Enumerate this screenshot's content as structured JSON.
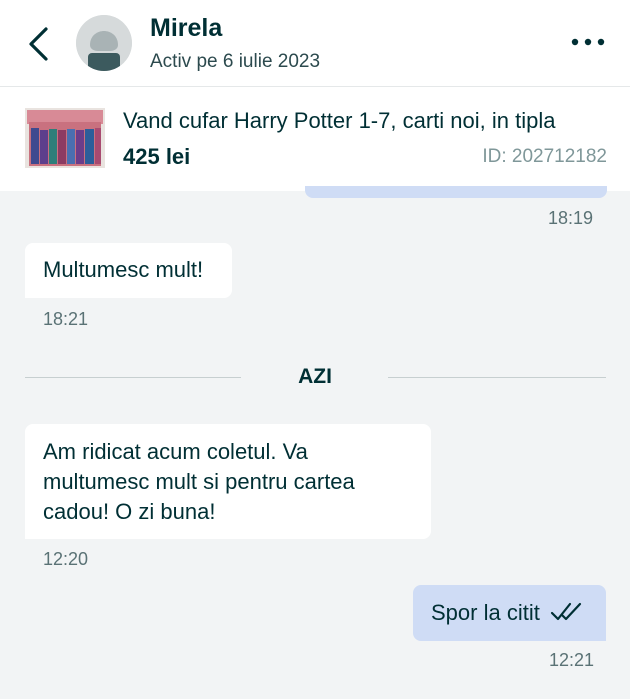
{
  "header": {
    "contact_name": "Mirela",
    "status": "Activ pe 6 iulie 2023"
  },
  "listing": {
    "title": "Vand cufar Harry Potter 1-7, carti noi, in tipla",
    "price": "425 lei",
    "id_text": "ID: 202712182"
  },
  "messages": [
    {
      "direction": "outgoing",
      "text": "",
      "time": "18:19"
    },
    {
      "direction": "incoming",
      "text": "Multumesc mult!",
      "time": "18:21"
    },
    {
      "direction": "incoming",
      "text": "Am ridicat acum coletul. Va multumesc mult si pentru cartea cadou! O zi buna!",
      "time": "12:20"
    },
    {
      "direction": "outgoing",
      "text": "Spor la citit",
      "time": "12:21",
      "read": true
    }
  ],
  "divider": {
    "label": "AZI"
  },
  "colors": {
    "background": "#f2f4f5",
    "outgoing_bubble": "#cfdcf5",
    "incoming_bubble": "#ffffff",
    "text_primary": "#002f34"
  },
  "icons": {
    "back": "chevron-left-icon",
    "more": "more-horizontal-icon",
    "read_receipt": "double-check-icon"
  }
}
